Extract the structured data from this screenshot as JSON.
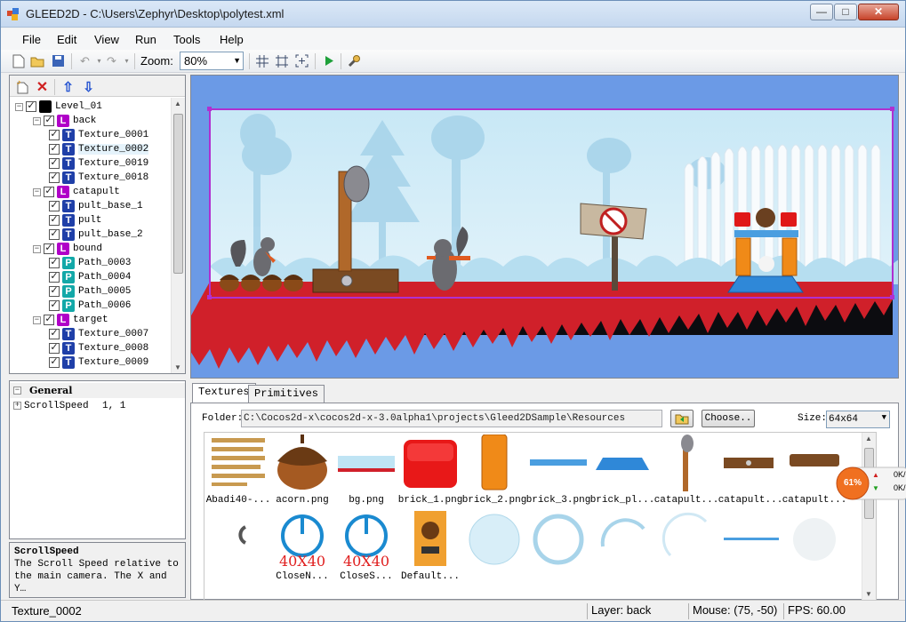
{
  "window": {
    "title": "GLEED2D - C:\\Users\\Zephyr\\Desktop\\polytest.xml",
    "min_glyph": "—",
    "max_glyph": "□",
    "close_glyph": "✕"
  },
  "menu": [
    "File",
    "Edit",
    "View",
    "Run",
    "Tools",
    "Help"
  ],
  "toolbar": {
    "zoom_label": "Zoom:",
    "zoom_value": "80%"
  },
  "tree": {
    "nodes": [
      {
        "label": "Level_01",
        "kind": "level"
      },
      {
        "label": "back",
        "kind": "L"
      },
      {
        "label": "Texture_0001",
        "kind": "T"
      },
      {
        "label": "Texture_0002",
        "kind": "T"
      },
      {
        "label": "Texture_0019",
        "kind": "T"
      },
      {
        "label": "Texture_0018",
        "kind": "T"
      },
      {
        "label": "catapult",
        "kind": "L"
      },
      {
        "label": "pult_base_1",
        "kind": "T"
      },
      {
        "label": "pult",
        "kind": "T"
      },
      {
        "label": "pult_base_2",
        "kind": "T"
      },
      {
        "label": "bound",
        "kind": "L"
      },
      {
        "label": "Path_0003",
        "kind": "P"
      },
      {
        "label": "Path_0004",
        "kind": "P"
      },
      {
        "label": "Path_0005",
        "kind": "P"
      },
      {
        "label": "Path_0006",
        "kind": "P"
      },
      {
        "label": "target",
        "kind": "L"
      },
      {
        "label": "Texture_0007",
        "kind": "T"
      },
      {
        "label": "Texture_0008",
        "kind": "T"
      },
      {
        "label": "Texture_0009",
        "kind": "T"
      }
    ],
    "badges": {
      "L": "L",
      "T": "T",
      "P": "P"
    }
  },
  "properties": {
    "category": "General",
    "prop_name": "ScrollSpeed",
    "prop_value": "1, 1",
    "desc_title": "ScrollSpeed",
    "desc_text": "The Scroll Speed relative to the main camera. The X and Y…"
  },
  "tabs": {
    "textures": "Textures",
    "primitives": "Primitives"
  },
  "browser": {
    "folder_label": "Folder:",
    "folder_path": "C:\\Cocos2d-x\\cocos2d-x-3.0alpha1\\projects\\Gleed2DSample\\Resources",
    "choose_label": "Choose..",
    "size_label": "Size:",
    "size_value": "64x64",
    "row1": [
      "Abadi40-...",
      "acorn.png",
      "bg.png",
      "brick_1.png",
      "brick_2.png",
      "brick_3.png",
      "brick_pl...",
      "catapult...",
      "catapult...",
      "catapult..."
    ],
    "row2_captions": [
      "",
      "CloseN...",
      "CloseS...",
      "Default...",
      "",
      "",
      "",
      "",
      "",
      ""
    ],
    "thumb_text_40x40": "40X40"
  },
  "status": {
    "selected": "Texture_0002",
    "layer": "Layer: back",
    "mouse": "Mouse: (75, -50)",
    "fps": "FPS: 60.00"
  },
  "netmon": {
    "percent": "61%",
    "up": "0K/",
    "down": "0K/"
  },
  "colors": {
    "canvas_bg": "#6b9ae6",
    "level_border": "#b030d0",
    "ground_red": "#d0202a",
    "badge_L": "#b000c8",
    "badge_T": "#1f3fa8",
    "badge_P": "#12a8a8"
  }
}
